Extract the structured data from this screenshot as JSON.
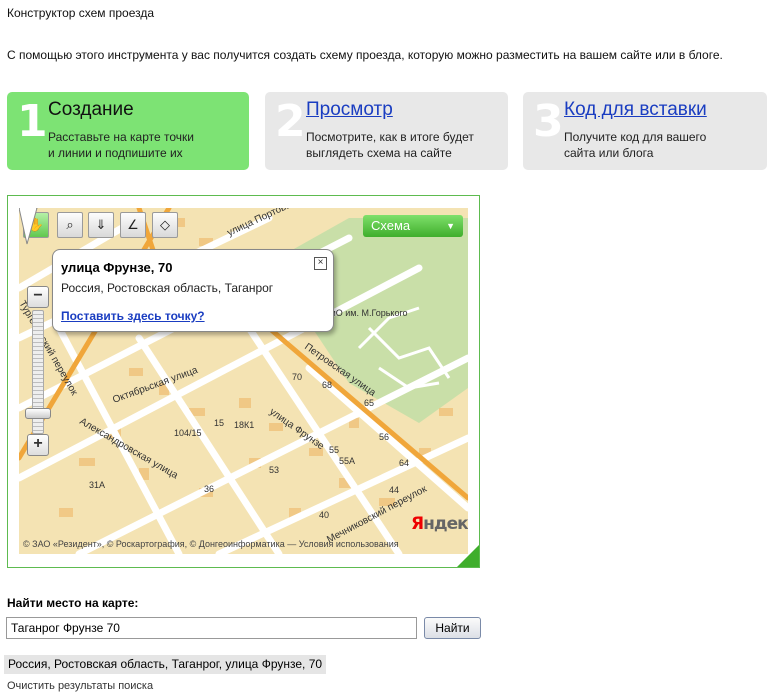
{
  "page_title": "Конструктор схем проезда",
  "intro": "С помощью этого инструмента у вас получится создать схему проезда, которую можно разместить на вашем сайте или в блоге.",
  "steps": [
    {
      "number": "1",
      "title": "Создание",
      "line1": "Расставьте на карте точки",
      "line2": "и линии и подпишите их"
    },
    {
      "number": "2",
      "title": "Просмотр",
      "line1": "Посмотрите, как в итоге будет",
      "line2": "выглядеть схема на сайте"
    },
    {
      "number": "3",
      "title": "Код для вставки",
      "line1": "Получите код для вашего",
      "line2": "сайта или блога"
    }
  ],
  "map": {
    "layer_label": "Схема",
    "balloon": {
      "title": "улица Фрунзе, 70",
      "address": "Россия, Ростовская область, Таганрог",
      "link": "Поставить здесь точку?"
    },
    "zoom": {
      "minus": "−",
      "plus": "+"
    },
    "copyright": "© ЗАО «Резидент», © Роскартография, © Донгеоинформатика — Условия использования",
    "logo": {
      "first": "Я",
      "rest": "ндекс"
    },
    "street_labels": {
      "s1": "улица Портова",
      "s2": "Октябрьская улица",
      "s3": "Александровская улица",
      "s4": "улица Фрунзе",
      "s5": "Петровская улица",
      "s6": "Тургеневский переулок",
      "s7": "Мечниковский переулок",
      "park": "ПКиО им. М.Горького"
    },
    "house_numbers": {
      "h1": "70",
      "h2": "68",
      "h3": "15",
      "h4": "18К1",
      "h5": "104/15",
      "h6": "55",
      "h7": "55А",
      "h8": "31А",
      "h9": "36",
      "h10": "53",
      "h11": "56",
      "h12": "64",
      "h13": "44",
      "h14": "65",
      "h15": "40"
    }
  },
  "search": {
    "label": "Найти место на карте:",
    "value": "Таганрог Фрунзе 70",
    "button": "Найти"
  },
  "results": {
    "item": "Россия, Ростовская область, Таганрог, улица Фрунзе, 70",
    "clear": "Очистить результаты поиска"
  }
}
